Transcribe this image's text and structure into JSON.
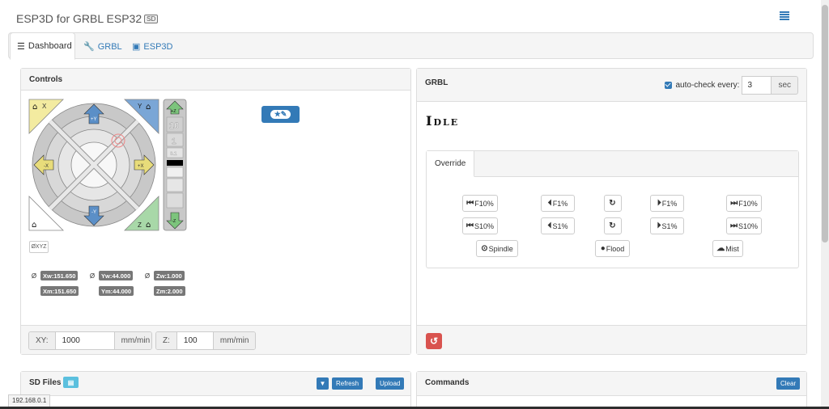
{
  "header": {
    "title": "ESP3D for GRBL ESP32",
    "sd_badge": "SD"
  },
  "tabs": [
    {
      "label": "Dashboard",
      "icon": "server-icon"
    },
    {
      "label": "GRBL",
      "icon": "wrench-icon"
    },
    {
      "label": "ESP3D",
      "icon": "hdd-icon"
    }
  ],
  "controls": {
    "title": "Controls",
    "jog": {
      "home_x": "X",
      "home_y": "Y",
      "home_z": "Z",
      "minus_x": "-X",
      "plus_x": "+X",
      "plus_y": "+Y",
      "minus_y": "-Y",
      "plus_z": "+Z",
      "minus_z": "-Z",
      "z_steps": [
        "10",
        "1",
        "0.1"
      ]
    },
    "zero_xyz": "ØXYZ",
    "zero_glyph": "Ø",
    "positions": {
      "xw": "Xw:151.650",
      "yw": "Yw:44.000",
      "zw": "Zw:1.000",
      "xm": "Xm:151.650",
      "ym": "Ym:44.000",
      "zm": "Zm:2.000"
    },
    "feed": {
      "xy_label": "XY:",
      "xy_value": "1000",
      "xy_unit": "mm/min",
      "z_label": "Z:",
      "z_value": "100",
      "z_unit": "mm/min"
    }
  },
  "grbl": {
    "title": "GRBL",
    "autocheck_label": "auto-check every:",
    "autocheck_value": "3",
    "autocheck_unit": "sec",
    "state": "Idle",
    "override_tab": "Override",
    "override_rows": [
      [
        "F10%",
        "F1%",
        "",
        "F1%",
        "F10%"
      ],
      [
        "S10%",
        "S1%",
        "",
        "S1%",
        "S10%"
      ]
    ],
    "spindle": "Spindle",
    "flood": "Flood",
    "mist": "Mist"
  },
  "sd": {
    "title": "SD Files",
    "refresh": "Refresh",
    "upload": "Upload"
  },
  "commands": {
    "title": "Commands",
    "clear": "Clear"
  },
  "status_url": "192.168.0.1",
  "colors": {
    "accent": "#337ab7",
    "danger": "#d9534f",
    "info": "#5bc0de",
    "badge": "#777777"
  }
}
